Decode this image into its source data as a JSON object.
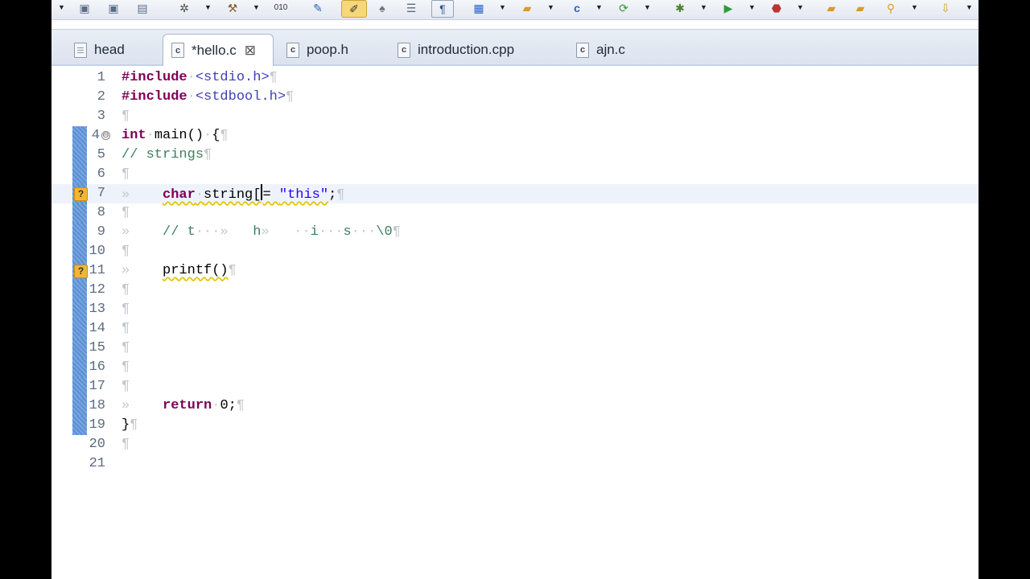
{
  "toolbar": {
    "icons": [
      "dropdown-arrow",
      "save-icon",
      "save-all-icon",
      "print-icon",
      "settings-gear-icon",
      "build-hammer-icon",
      "binary-icon",
      "search-wand-icon",
      "pen-icon",
      "paintbrush-icon",
      "list-icon",
      "format-icon",
      "new-c-project-icon",
      "open-folder-icon",
      "new-c-file-icon",
      "refresh-icon",
      "debug-bug-icon",
      "run-icon",
      "external-tools-icon",
      "open-project-icon",
      "folder-icon",
      "search-icon",
      "next-annotation-icon"
    ]
  },
  "tabs": [
    {
      "label": "head",
      "active": false,
      "icon": "file-icon"
    },
    {
      "label": "*hello.c",
      "active": true,
      "icon": "c-file-icon",
      "close": "⊠"
    },
    {
      "label": "poop.h",
      "active": false,
      "icon": "c-file-icon"
    },
    {
      "label": "introduction.cpp",
      "active": false,
      "icon": "c-file-icon"
    },
    {
      "label": "ajn.c",
      "active": false,
      "icon": "c-file-icon"
    }
  ],
  "editor": {
    "lines": [
      {
        "num": "1"
      },
      {
        "num": "2"
      },
      {
        "num": "3"
      },
      {
        "num": "4"
      },
      {
        "num": "5"
      },
      {
        "num": "6"
      },
      {
        "num": "7"
      },
      {
        "num": "8"
      },
      {
        "num": "9"
      },
      {
        "num": "10"
      },
      {
        "num": "11"
      },
      {
        "num": "12"
      },
      {
        "num": "13"
      },
      {
        "num": "14"
      },
      {
        "num": "15"
      },
      {
        "num": "16"
      },
      {
        "num": "17"
      },
      {
        "num": "18"
      },
      {
        "num": "19"
      },
      {
        "num": "20"
      },
      {
        "num": "21"
      }
    ],
    "tokens": {
      "include_kw": "#include",
      "stdio": "<stdio.h>",
      "stdbool": "<stdbool.h>",
      "int_kw": "int",
      "main_sig": "main()",
      "brace_open": "{",
      "comment_strings": "// strings",
      "char_kw": "char",
      "string_decl": "string[",
      "string_eq": "= ",
      "string_lit": "\"this\"",
      "semicolon": ";",
      "comment_chars_t": "// t",
      "comment_chars_h": "h",
      "comment_chars_i": "i",
      "comment_chars_s": "s",
      "comment_chars_null": "\\0",
      "printf_call": "printf()",
      "return_kw": "return",
      "return_val": "0;",
      "brace_close": "}",
      "pilcrow": "¶",
      "tab_mark": "»",
      "dot": "·"
    },
    "warning_glyph": "?",
    "fold_glyph": "⊖"
  },
  "colors": {
    "keyword": "#7f0055",
    "include": "#3f41b8",
    "comment": "#3f7f5f",
    "string": "#2a00ff",
    "whitespace": "#c3c8cf",
    "marker": "#5b8fd1",
    "warning": "#f2b632"
  }
}
